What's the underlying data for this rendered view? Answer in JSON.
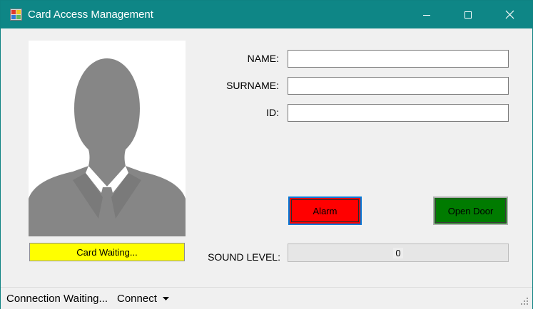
{
  "window": {
    "title": "Card Access Management",
    "titlebar_color": "#0e8686",
    "icons": {
      "app": "app-icon",
      "minimize": "minimize-icon",
      "maximize": "maximize-icon",
      "close": "close-icon"
    }
  },
  "photo": {
    "icon": "person-silhouette-icon",
    "status_text": "Card Waiting...",
    "status_color": "#ffff00"
  },
  "form": {
    "name_label": "NAME:",
    "name_value": "",
    "surname_label": "SURNAME:",
    "surname_value": "",
    "id_label": "ID:",
    "id_value": ""
  },
  "buttons": {
    "alarm_label": "Alarm",
    "alarm_color": "#ff0000",
    "open_door_label": "Open Door",
    "open_door_color": "#007b00"
  },
  "sound": {
    "label": "SOUND LEVEL:",
    "value": 0,
    "value_text": "0"
  },
  "statusbar": {
    "connection_status": "Connection Waiting...",
    "connect_label": "Connect",
    "dropdown_icon": "dropdown-arrow-icon",
    "grip_icon": "resize-grip-icon"
  }
}
